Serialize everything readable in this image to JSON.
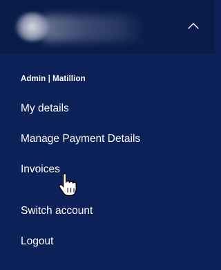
{
  "header": {
    "avatar_icon": "blurred-avatar",
    "name_icon": "blurred-account-name",
    "toggle_icon": "chevron-up-icon"
  },
  "org_label": "Admin | Matillion",
  "menu": {
    "items": [
      {
        "label": "My details"
      },
      {
        "label": "Manage Payment Details"
      },
      {
        "label": "Invoices"
      },
      {
        "label": "Switch account"
      },
      {
        "label": "Logout"
      }
    ]
  },
  "cursor_icon": "hand-pointer-icon",
  "colors": {
    "panel_bg": "#0b2157",
    "header_bg": "#0a1c49",
    "text": "#ffffff"
  }
}
